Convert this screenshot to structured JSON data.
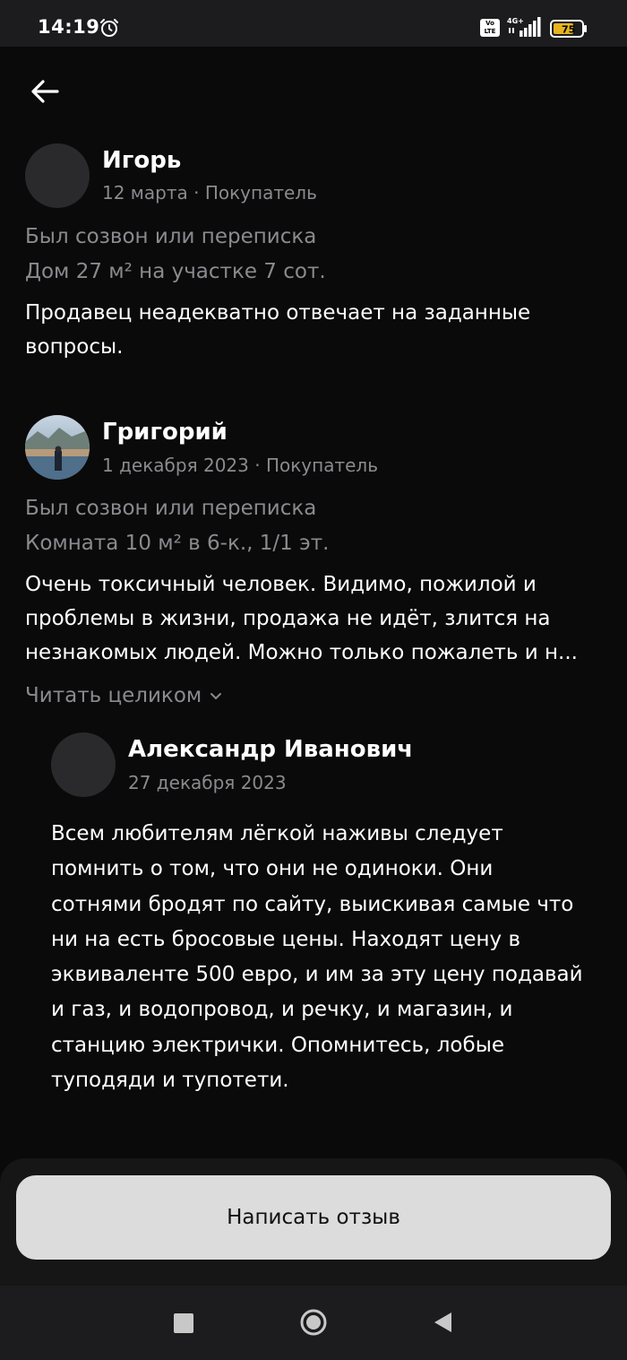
{
  "status_bar": {
    "time": "14:19",
    "volte": "Vo LTE",
    "network": "4G+",
    "battery": "75"
  },
  "reviews": [
    {
      "author": "Игорь",
      "meta": "12 марта · Покупатель",
      "contact_type": "Был созвон или переписка",
      "listing": "Дом 27 м² на участке 7 сот.",
      "text_lines": [
        "Продавец неадекватно отвечает на заданные",
        "вопросы."
      ]
    },
    {
      "author": "Григорий",
      "meta": "1 декабря 2023 · Покупатель",
      "contact_type": "Был созвон или переписка",
      "listing": "Комната 10 м² в 6-к., 1/1 эт.",
      "text_lines": [
        "Очень токсичный человек. Видимо, пожилой и",
        "проблемы в жизни, продажа не идёт, злится на",
        "незнакомых людей. Можно только пожалеть и н..."
      ],
      "read_more": "Читать целиком"
    }
  ],
  "reply": {
    "author": "Александр Иванович",
    "date": "27 декабря 2023",
    "text_lines": [
      "Всем любителям лёгкой наживы следует",
      "помнить о том, что они не одиноки. Они",
      "сотнями бродят по сайту, выискивая самые что",
      "ни на есть бросовые цены. Находят цену в",
      "эквиваленте 500 евро, и им за эту цену подавай",
      "и газ, и водопровод, и речку, и магазин, и",
      "станцию электрички. Опомнитесь, лобые",
      "туподяди и тупотети."
    ]
  },
  "actions": {
    "write_review": "Написать отзыв"
  },
  "icons": {
    "back": "arrow-left-icon",
    "alarm": "alarm-clock-icon",
    "signal": "signal-icon",
    "battery": "battery-icon",
    "chevron": "chevron-down-icon"
  },
  "colors": {
    "background": "#0a0a0a",
    "muted_text": "#8a8a8f",
    "button": "#dcdcdc",
    "battery_fill": "#e6b422"
  }
}
